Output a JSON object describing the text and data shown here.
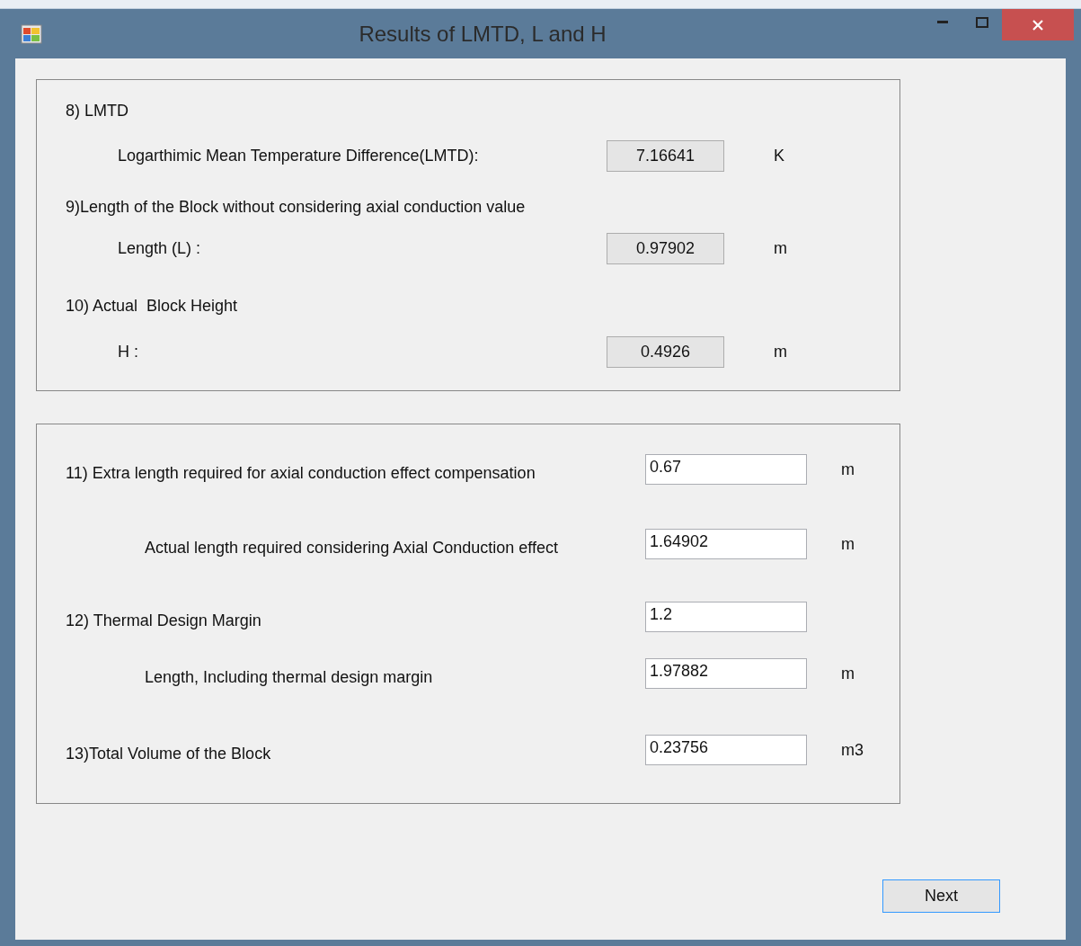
{
  "window": {
    "title": "Results of LMTD, L and H"
  },
  "groups": [
    {
      "rows": [
        {
          "kind": "heading",
          "label": "8) LMTD"
        },
        {
          "kind": "readout",
          "label": "Logarthimic Mean Temperature Difference(LMTD):",
          "value": "7.16641",
          "unit": "K"
        },
        {
          "kind": "heading",
          "label": "9)Length of the Block without considering axial conduction value"
        },
        {
          "kind": "readout",
          "label": "Length (L) :",
          "value": "0.97902",
          "unit": "m"
        },
        {
          "kind": "heading",
          "label": "10) Actual  Block Height"
        },
        {
          "kind": "readout",
          "label": "H :",
          "value": "0.4926",
          "unit": "m"
        }
      ]
    },
    {
      "rows": [
        {
          "kind": "field",
          "label": "11) Extra length required for axial conduction effect compensation",
          "value": "0.67",
          "unit": "m"
        },
        {
          "kind": "subfield",
          "label": "Actual length required considering Axial Conduction effect",
          "value": "1.64902",
          "unit": "m"
        },
        {
          "kind": "field",
          "label": "12) Thermal Design Margin",
          "value": "1.2"
        },
        {
          "kind": "subfield",
          "label": "Length, Including thermal design margin",
          "value": "1.97882",
          "unit": "m"
        },
        {
          "kind": "field",
          "label": "13)Total Volume of the Block",
          "value": "0.23756",
          "unit": "m3"
        }
      ]
    }
  ],
  "buttons": [
    {
      "label": "Next"
    }
  ]
}
